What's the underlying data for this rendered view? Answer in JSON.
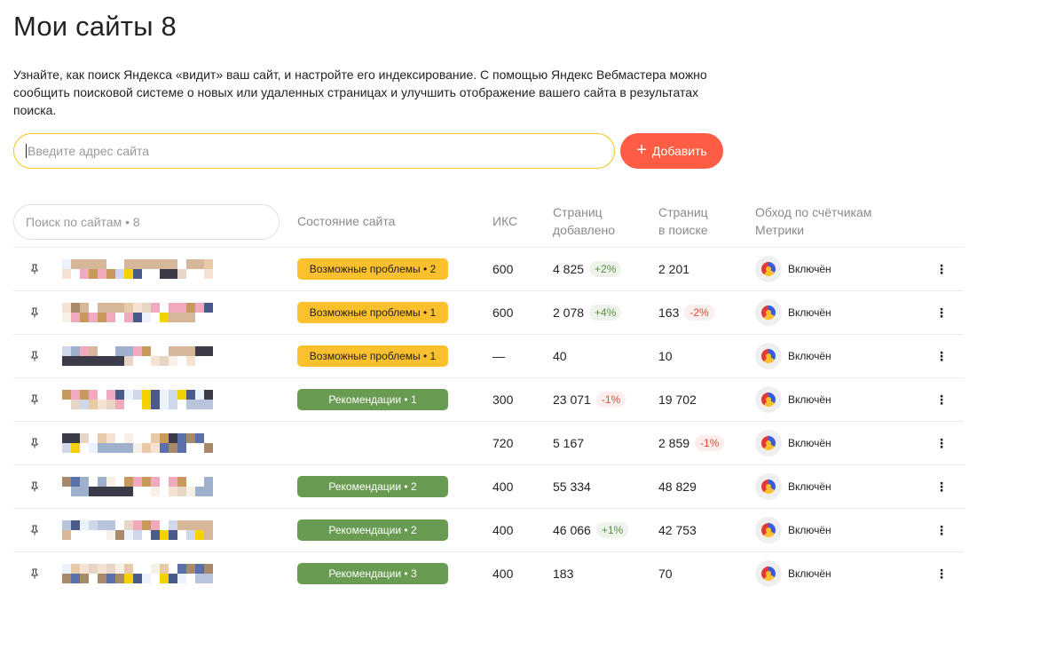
{
  "page": {
    "title": "Мои сайты 8",
    "intro": "Узнайте, как поиск Яндекса «видит» ваш сайт, и настройте его индексирование. С помощью Яндекс Вебмастера можно сообщить поисковой системе о новых или удаленных страницах и улучшить отображение вашего сайта в результатах поиска."
  },
  "add_site": {
    "placeholder": "Введите адрес сайта",
    "button_label": "Добавить",
    "button_icon": "plus-icon",
    "accent": "#ff5c45"
  },
  "table": {
    "search_placeholder": "Поиск по сайтам • 8",
    "headers": {
      "state": "Состояние сайта",
      "iks": "ИКС",
      "added_line1": "Страниц",
      "added_line2": "добавлено",
      "insearch_line1": "Страниц",
      "insearch_line2": "в поиске",
      "metrika_line1": "Обход по счётчикам",
      "metrika_line2": "Метрики"
    },
    "colors": {
      "warning": "#fbc02d",
      "recommendation": "#6a9b52",
      "delta_pos": "#5a8f45",
      "delta_neg": "#e04a3a"
    },
    "rows": [
      {
        "state": "Возможные проблемы • 2",
        "state_type": "warn",
        "iks": "600",
        "added": "4 825",
        "added_delta": "+2%",
        "added_delta_type": "pos",
        "insearch": "2 201",
        "insearch_delta": "",
        "insearch_delta_type": "",
        "metrika": "Включён"
      },
      {
        "state": "Возможные проблемы • 1",
        "state_type": "warn",
        "iks": "600",
        "added": "2 078",
        "added_delta": "+4%",
        "added_delta_type": "pos",
        "insearch": "163",
        "insearch_delta": "-2%",
        "insearch_delta_type": "neg",
        "metrika": "Включён"
      },
      {
        "state": "Возможные проблемы • 1",
        "state_type": "warn",
        "iks": "—",
        "added": "40",
        "added_delta": "",
        "added_delta_type": "",
        "insearch": "10",
        "insearch_delta": "",
        "insearch_delta_type": "",
        "metrika": "Включён"
      },
      {
        "state": "Рекомендации • 1",
        "state_type": "rec",
        "iks": "300",
        "added": "23 071",
        "added_delta": "-1%",
        "added_delta_type": "neg",
        "insearch": "19 702",
        "insearch_delta": "",
        "insearch_delta_type": "",
        "metrika": "Включён"
      },
      {
        "state": "",
        "state_type": "",
        "iks": "720",
        "added": "5 167",
        "added_delta": "",
        "added_delta_type": "",
        "insearch": "2 859",
        "insearch_delta": "-1%",
        "insearch_delta_type": "neg",
        "metrika": "Включён"
      },
      {
        "state": "Рекомендации • 2",
        "state_type": "rec",
        "iks": "400",
        "added": "55 334",
        "added_delta": "",
        "added_delta_type": "",
        "insearch": "48 829",
        "insearch_delta": "",
        "insearch_delta_type": "",
        "metrika": "Включён"
      },
      {
        "state": "Рекомендации • 2",
        "state_type": "rec",
        "iks": "400",
        "added": "46 066",
        "added_delta": "+1%",
        "added_delta_type": "pos",
        "insearch": "42 753",
        "insearch_delta": "",
        "insearch_delta_type": "",
        "metrika": "Включён"
      },
      {
        "state": "Рекомендации • 3",
        "state_type": "rec",
        "iks": "400",
        "added": "183",
        "added_delta": "",
        "added_delta_type": "",
        "insearch": "70",
        "insearch_delta": "",
        "insearch_delta_type": "",
        "metrika": "Включён"
      }
    ],
    "row_icons": {
      "pin": "pin-icon",
      "metrika": "metrika-icon",
      "more": "more-vertical-icon"
    }
  }
}
